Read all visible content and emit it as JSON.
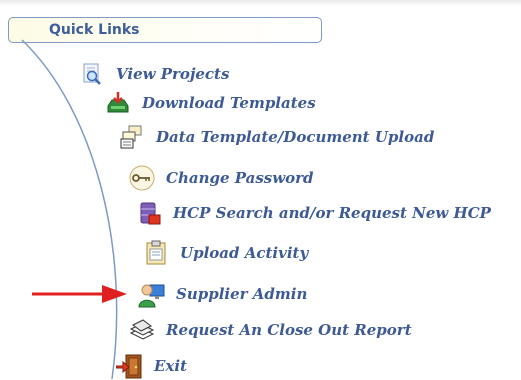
{
  "header": {
    "title": "Quick Links"
  },
  "links": [
    {
      "label": "View Projects",
      "icon": "magnifier-page-icon"
    },
    {
      "label": "Download Templates",
      "icon": "download-tray-icon"
    },
    {
      "label": "Data Template/Document Upload",
      "icon": "upload-documents-icon"
    },
    {
      "label": "Change Password",
      "icon": "key-icon"
    },
    {
      "label": "HCP Search and/or Request New HCP",
      "icon": "database-search-icon"
    },
    {
      "label": "Upload Activity",
      "icon": "clipboard-icon"
    },
    {
      "label": "Supplier Admin",
      "icon": "admin-user-icon"
    },
    {
      "label": "Request An Close Out Report",
      "icon": "report-stack-icon"
    },
    {
      "label": "Exit",
      "icon": "exit-door-icon"
    }
  ],
  "colors": {
    "link_text": "#3d5a95",
    "header_text": "#3c5e9b",
    "pointer_arrow": "#e02020",
    "arc": "#7d9bc4"
  }
}
